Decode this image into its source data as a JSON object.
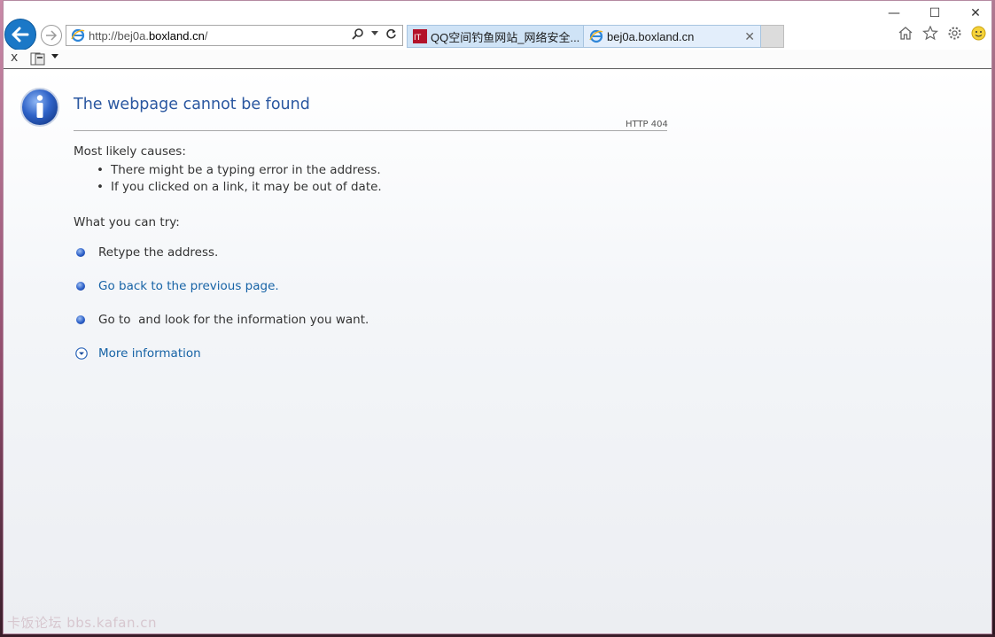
{
  "browser": {
    "address_url_prefix": "http://bej0a.",
    "address_url_domain": "boxland.cn",
    "address_url_suffix": "/",
    "tabs": [
      {
        "title": "QQ空间钓鱼网站_网络安全..."
      },
      {
        "title": "bej0a.boxland.cn"
      }
    ]
  },
  "error_page": {
    "title": "The webpage cannot be found",
    "code": "HTTP 404",
    "causes_heading": "Most likely causes:",
    "causes": [
      "There might be a typing error in the address.",
      "If you clicked on a link, it may be out of date."
    ],
    "try_heading": "What you can try:",
    "try_items": [
      "Retype the address.",
      "Go back to the previous page.",
      "Go to  and look for the information you want."
    ],
    "more_info": "More information"
  },
  "watermark": "卡饭论坛 bbs.kafan.cn",
  "colors": {
    "title": "#2a57a0",
    "link": "#1763a6",
    "back_button": "#1b78c7"
  }
}
